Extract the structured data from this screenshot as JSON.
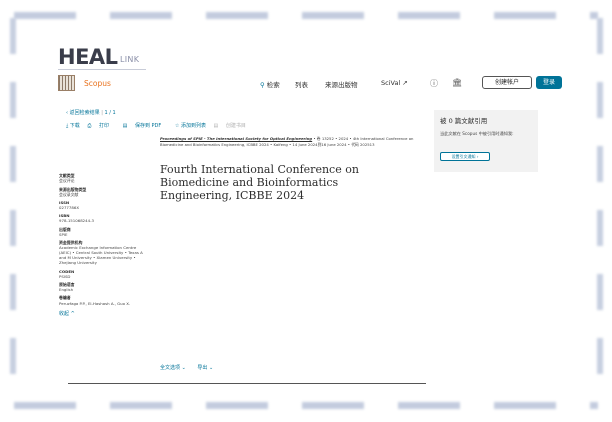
{
  "portal": {
    "logo_text": "HEAL",
    "logo_suffix": "LINK"
  },
  "header": {
    "brand": "Scopus",
    "search_label": "检索",
    "list_label": "列表",
    "sources_label": "来源出版物",
    "scival_label": "SciVal ↗",
    "create_account_label": "创建帐户",
    "login_label": "登录"
  },
  "results_nav": {
    "back_label": "‹ 返回检索结果",
    "separator": "|",
    "position": "1 / 1"
  },
  "toolbar": {
    "download_label": "⤓ 下载",
    "print_label": "打印",
    "save_pdf_label": "保存到 PDF",
    "add_list_label": "☆ 添加到列表",
    "bibliography_label": "创建书目"
  },
  "document": {
    "source_title": "Proceedings of SPIE - The International Society for Optical Engineering",
    "citation_rest": " • 卷 13252 • 2024 • 4th International Conference on Biomedicine and Bioinformatics Engineering, ICBBE 2024 • Kaifeng • 14 June 2024到16 June 2024 • 代码 202513",
    "title": "Fourth International Conference on Biomedicine and Bioinformatics Engineering, ICBBE 2024"
  },
  "metadata": [
    {
      "label": "文献类型",
      "value": "会议评论"
    },
    {
      "label": "来源出版物类型",
      "value": "会议录文献"
    },
    {
      "label": "ISSN",
      "value": "0277786X"
    },
    {
      "label": "ISBN",
      "value": "978-151068244-3"
    },
    {
      "label": "出版商",
      "value": "SPIE"
    },
    {
      "label": "资金提供机构",
      "value": "Academic Exchange Information Centre (AEIC) • Central South University • Texas A and M University • Xiamen University • Zhejiang University"
    },
    {
      "label": "CODEN",
      "value": "PSISD"
    },
    {
      "label": "原始语言",
      "value": "English"
    },
    {
      "label": "卷编者",
      "value": "Peruzfaga P.P., El-Hashash A., Guo X."
    }
  ],
  "collapse_label": "收起 ^",
  "footer": {
    "fulltext_label": "全文选项 ⌄",
    "export_label": "导出 ⌄"
  },
  "cited_by": {
    "title": "被 0 篇文献引用",
    "description": "当此文献在 Scopus 中被引用时通知我:",
    "button_label": "设置引文通知 ›"
  }
}
